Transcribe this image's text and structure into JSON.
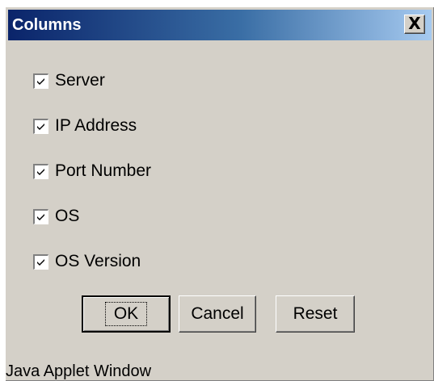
{
  "window": {
    "title": "Columns",
    "close_glyph": "X"
  },
  "columns": [
    {
      "label": "Server",
      "checked": true
    },
    {
      "label": "IP Address",
      "checked": true
    },
    {
      "label": "Port Number",
      "checked": true
    },
    {
      "label": "OS",
      "checked": true
    },
    {
      "label": "OS Version",
      "checked": true
    }
  ],
  "buttons": {
    "ok": "OK",
    "cancel": "Cancel",
    "reset": "Reset"
  },
  "status": {
    "text": "Java Applet Window"
  },
  "colors": {
    "dialog_bg": "#d4d0c8",
    "title_gradient_start": "#0a246a",
    "title_gradient_end": "#a6caf0",
    "title_text": "#ffffff"
  }
}
